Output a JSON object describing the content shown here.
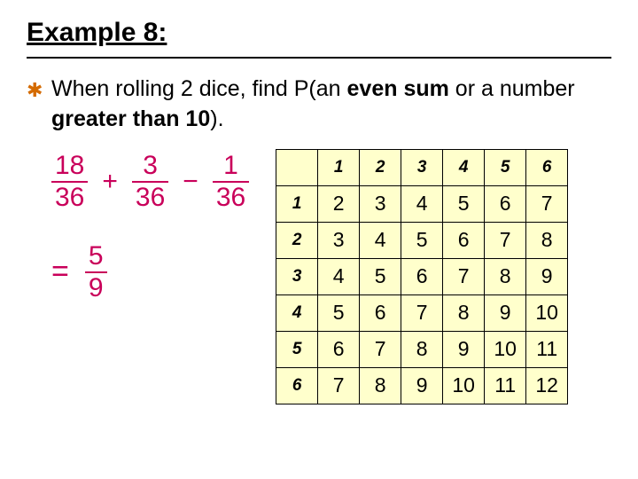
{
  "title": "Example 8:",
  "prompt": {
    "prefix": "When rolling 2 dice, find P(an ",
    "bold1": "even sum",
    "mid": " or a number ",
    "bold2": "greater than 10",
    "suffix": ")."
  },
  "math": {
    "f1n": "18",
    "f1d": "36",
    "op1": "+",
    "f2n": "3",
    "f2d": "36",
    "op2": "−",
    "f3n": "1",
    "f3d": "36",
    "eq": "=",
    "rn": "5",
    "rd": "9"
  },
  "table": {
    "col_headers": [
      "1",
      "2",
      "3",
      "4",
      "5",
      "6"
    ],
    "row_headers": [
      "1",
      "2",
      "3",
      "4",
      "5",
      "6"
    ],
    "rows": [
      [
        "2",
        "3",
        "4",
        "5",
        "6",
        "7"
      ],
      [
        "3",
        "4",
        "5",
        "6",
        "7",
        "8"
      ],
      [
        "4",
        "5",
        "6",
        "7",
        "8",
        "9"
      ],
      [
        "5",
        "6",
        "7",
        "8",
        "9",
        "10"
      ],
      [
        "6",
        "7",
        "8",
        "9",
        "10",
        "11"
      ],
      [
        "7",
        "8",
        "9",
        "10",
        "11",
        "12"
      ]
    ]
  }
}
